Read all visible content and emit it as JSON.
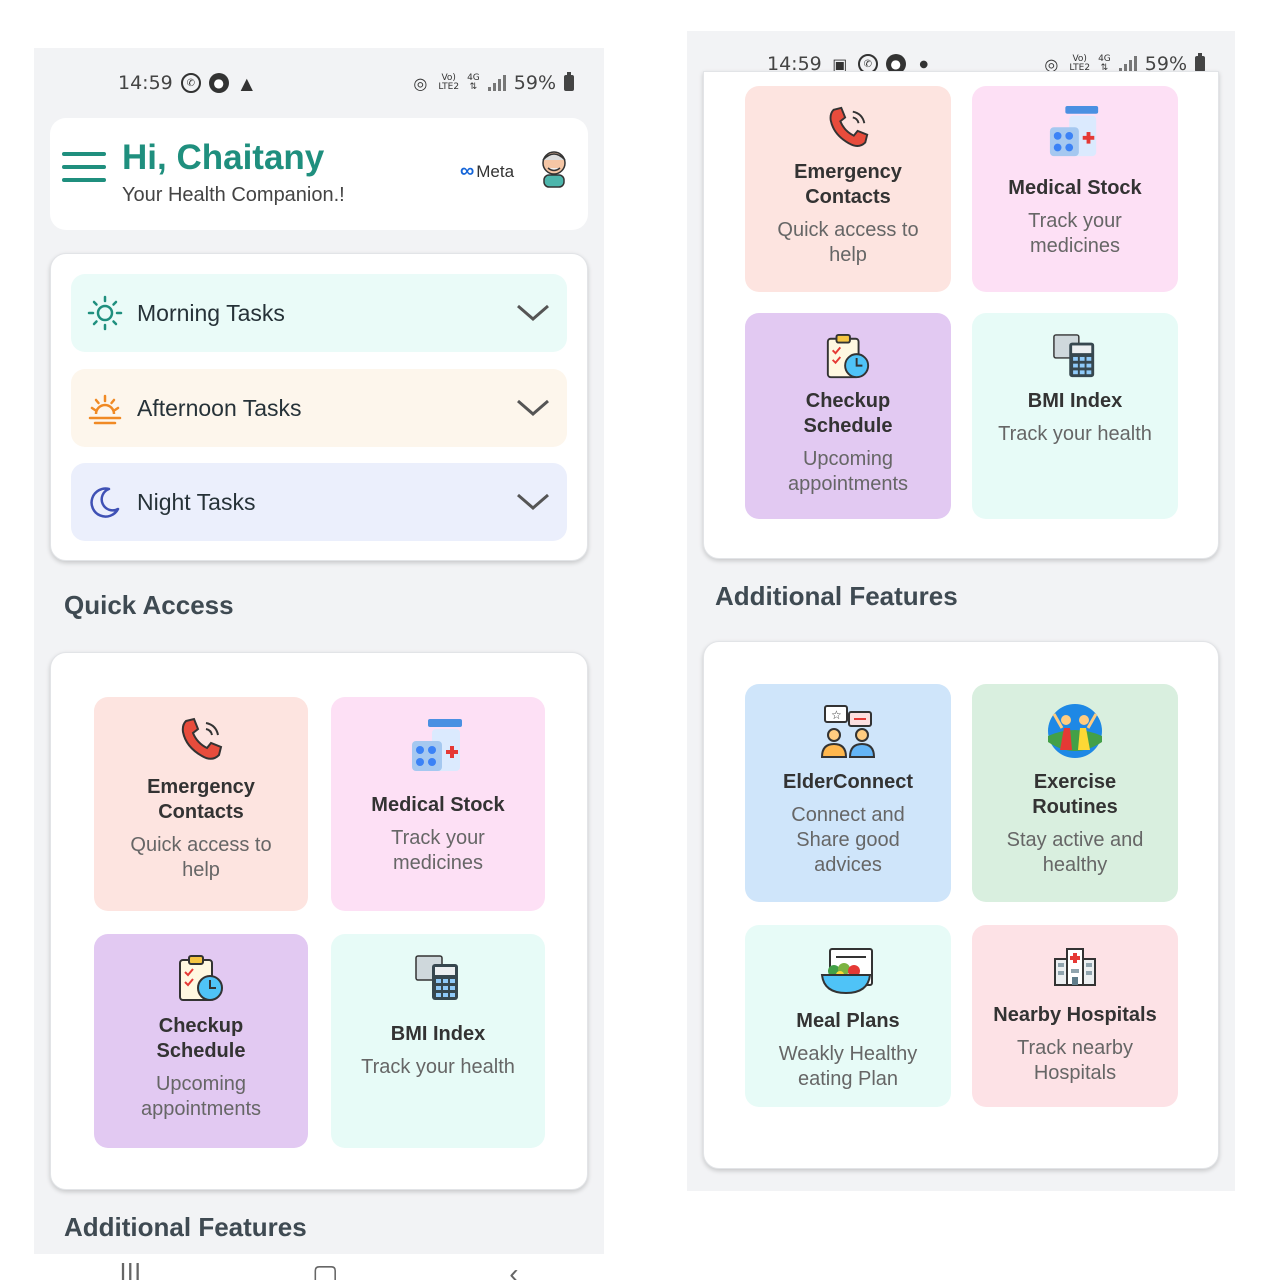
{
  "left": {
    "status": {
      "time": "14:59",
      "battery": "59%",
      "net_top": "Vo)",
      "net_bottom": "LTE2",
      "net_type": "4G"
    },
    "header": {
      "greeting": "Hi, Chaitany",
      "subtitle": "Your Health Companion.!",
      "brand": "Meta"
    },
    "tasks": [
      {
        "label": "Morning Tasks",
        "icon": "sun-icon"
      },
      {
        "label": "Afternoon Tasks",
        "icon": "sunset-icon"
      },
      {
        "label": "Night Tasks",
        "icon": "moon-icon"
      }
    ],
    "quick_access_title": "Quick Access",
    "quick_access": [
      {
        "title_1": "Emergency",
        "title_2": "Contacts",
        "desc_1": "Quick access to",
        "desc_2": "help",
        "icon": "phone-icon"
      },
      {
        "title": "Medical Stock",
        "desc_1": "Track your",
        "desc_2": "medicines",
        "icon": "pill-bottle-icon"
      },
      {
        "title_1": "Checkup",
        "title_2": "Schedule",
        "desc_1": "Upcoming",
        "desc_2": "appointments",
        "icon": "clipboard-clock-icon"
      },
      {
        "title": "BMI Index",
        "desc": "Track your health",
        "icon": "bmi-scale-icon"
      }
    ],
    "additional_title": "Additional Features"
  },
  "right": {
    "status": {
      "time": "14:59",
      "battery": "59%",
      "net_top": "Vo)",
      "net_bottom": "LTE2",
      "net_type": "4G"
    },
    "quick_access": [
      {
        "title_1": "Emergency",
        "title_2": "Contacts",
        "desc_1": "Quick access to",
        "desc_2": "help",
        "icon": "phone-icon"
      },
      {
        "title": "Medical Stock",
        "desc_1": "Track your",
        "desc_2": "medicines",
        "icon": "pill-bottle-icon"
      },
      {
        "title_1": "Checkup",
        "title_2": "Schedule",
        "desc_1": "Upcoming",
        "desc_2": "appointments",
        "icon": "clipboard-clock-icon"
      },
      {
        "title": "BMI Index",
        "desc": "Track your health",
        "icon": "bmi-scale-icon"
      }
    ],
    "additional_title": "Additional Features",
    "additional": [
      {
        "title": "ElderConnect",
        "desc_1": "Connect and",
        "desc_2": "Share good",
        "desc_3": "advices",
        "icon": "people-chat-icon"
      },
      {
        "title_1": "Exercise",
        "title_2": "Routines",
        "desc_1": "Stay active and",
        "desc_2": "healthy",
        "icon": "exercise-icon"
      },
      {
        "title": "Meal Plans",
        "desc_1": "Weakly Healthy",
        "desc_2": "eating Plan",
        "icon": "salad-bowl-icon"
      },
      {
        "title": "Nearby Hospitals",
        "desc_1": "Track nearby",
        "desc_2": "Hospitals",
        "icon": "hospital-icon"
      }
    ]
  },
  "colors": {
    "accent": "#1f8f7e",
    "morning_bg": "#eafbf8",
    "afternoon_bg": "#fdf6ec",
    "night_bg": "#ebeffc"
  }
}
